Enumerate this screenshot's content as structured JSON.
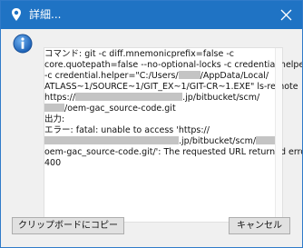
{
  "window": {
    "title": "詳細...",
    "accent_color": "#1f73c4"
  },
  "icons": {
    "app": "location-pin-icon",
    "close": "close-icon",
    "info": "info-icon"
  },
  "message": {
    "line01": "コマンド: git -c diff.mnemonicprefix=false -c",
    "line02": "core.quotepath=false --no-optional-locks -c credential.helper=",
    "line03a": "-c credential.helper=\"C:/Users/",
    "line03b": "/AppData/Local/",
    "line04": "ATLASS~1/SOURCE~1/GIT_EX~1/GIT-CR~1.EXE\" ls-remote",
    "line05a": "https://",
    "line05b": ".jp/bitbucket/scm/",
    "line06b": "/oem-gac_source-code.git",
    "line07": "出力:",
    "line08": "エラー: fatal: unable to access 'https://",
    "line09b": ".jp/bitbucket/scm/",
    "line09c": "/",
    "line10": "oem-gac_source-code.git/': The requested URL returned error:",
    "line11": "400"
  },
  "buttons": {
    "copy": "クリップボードにコピー",
    "cancel": "キャンセル"
  }
}
